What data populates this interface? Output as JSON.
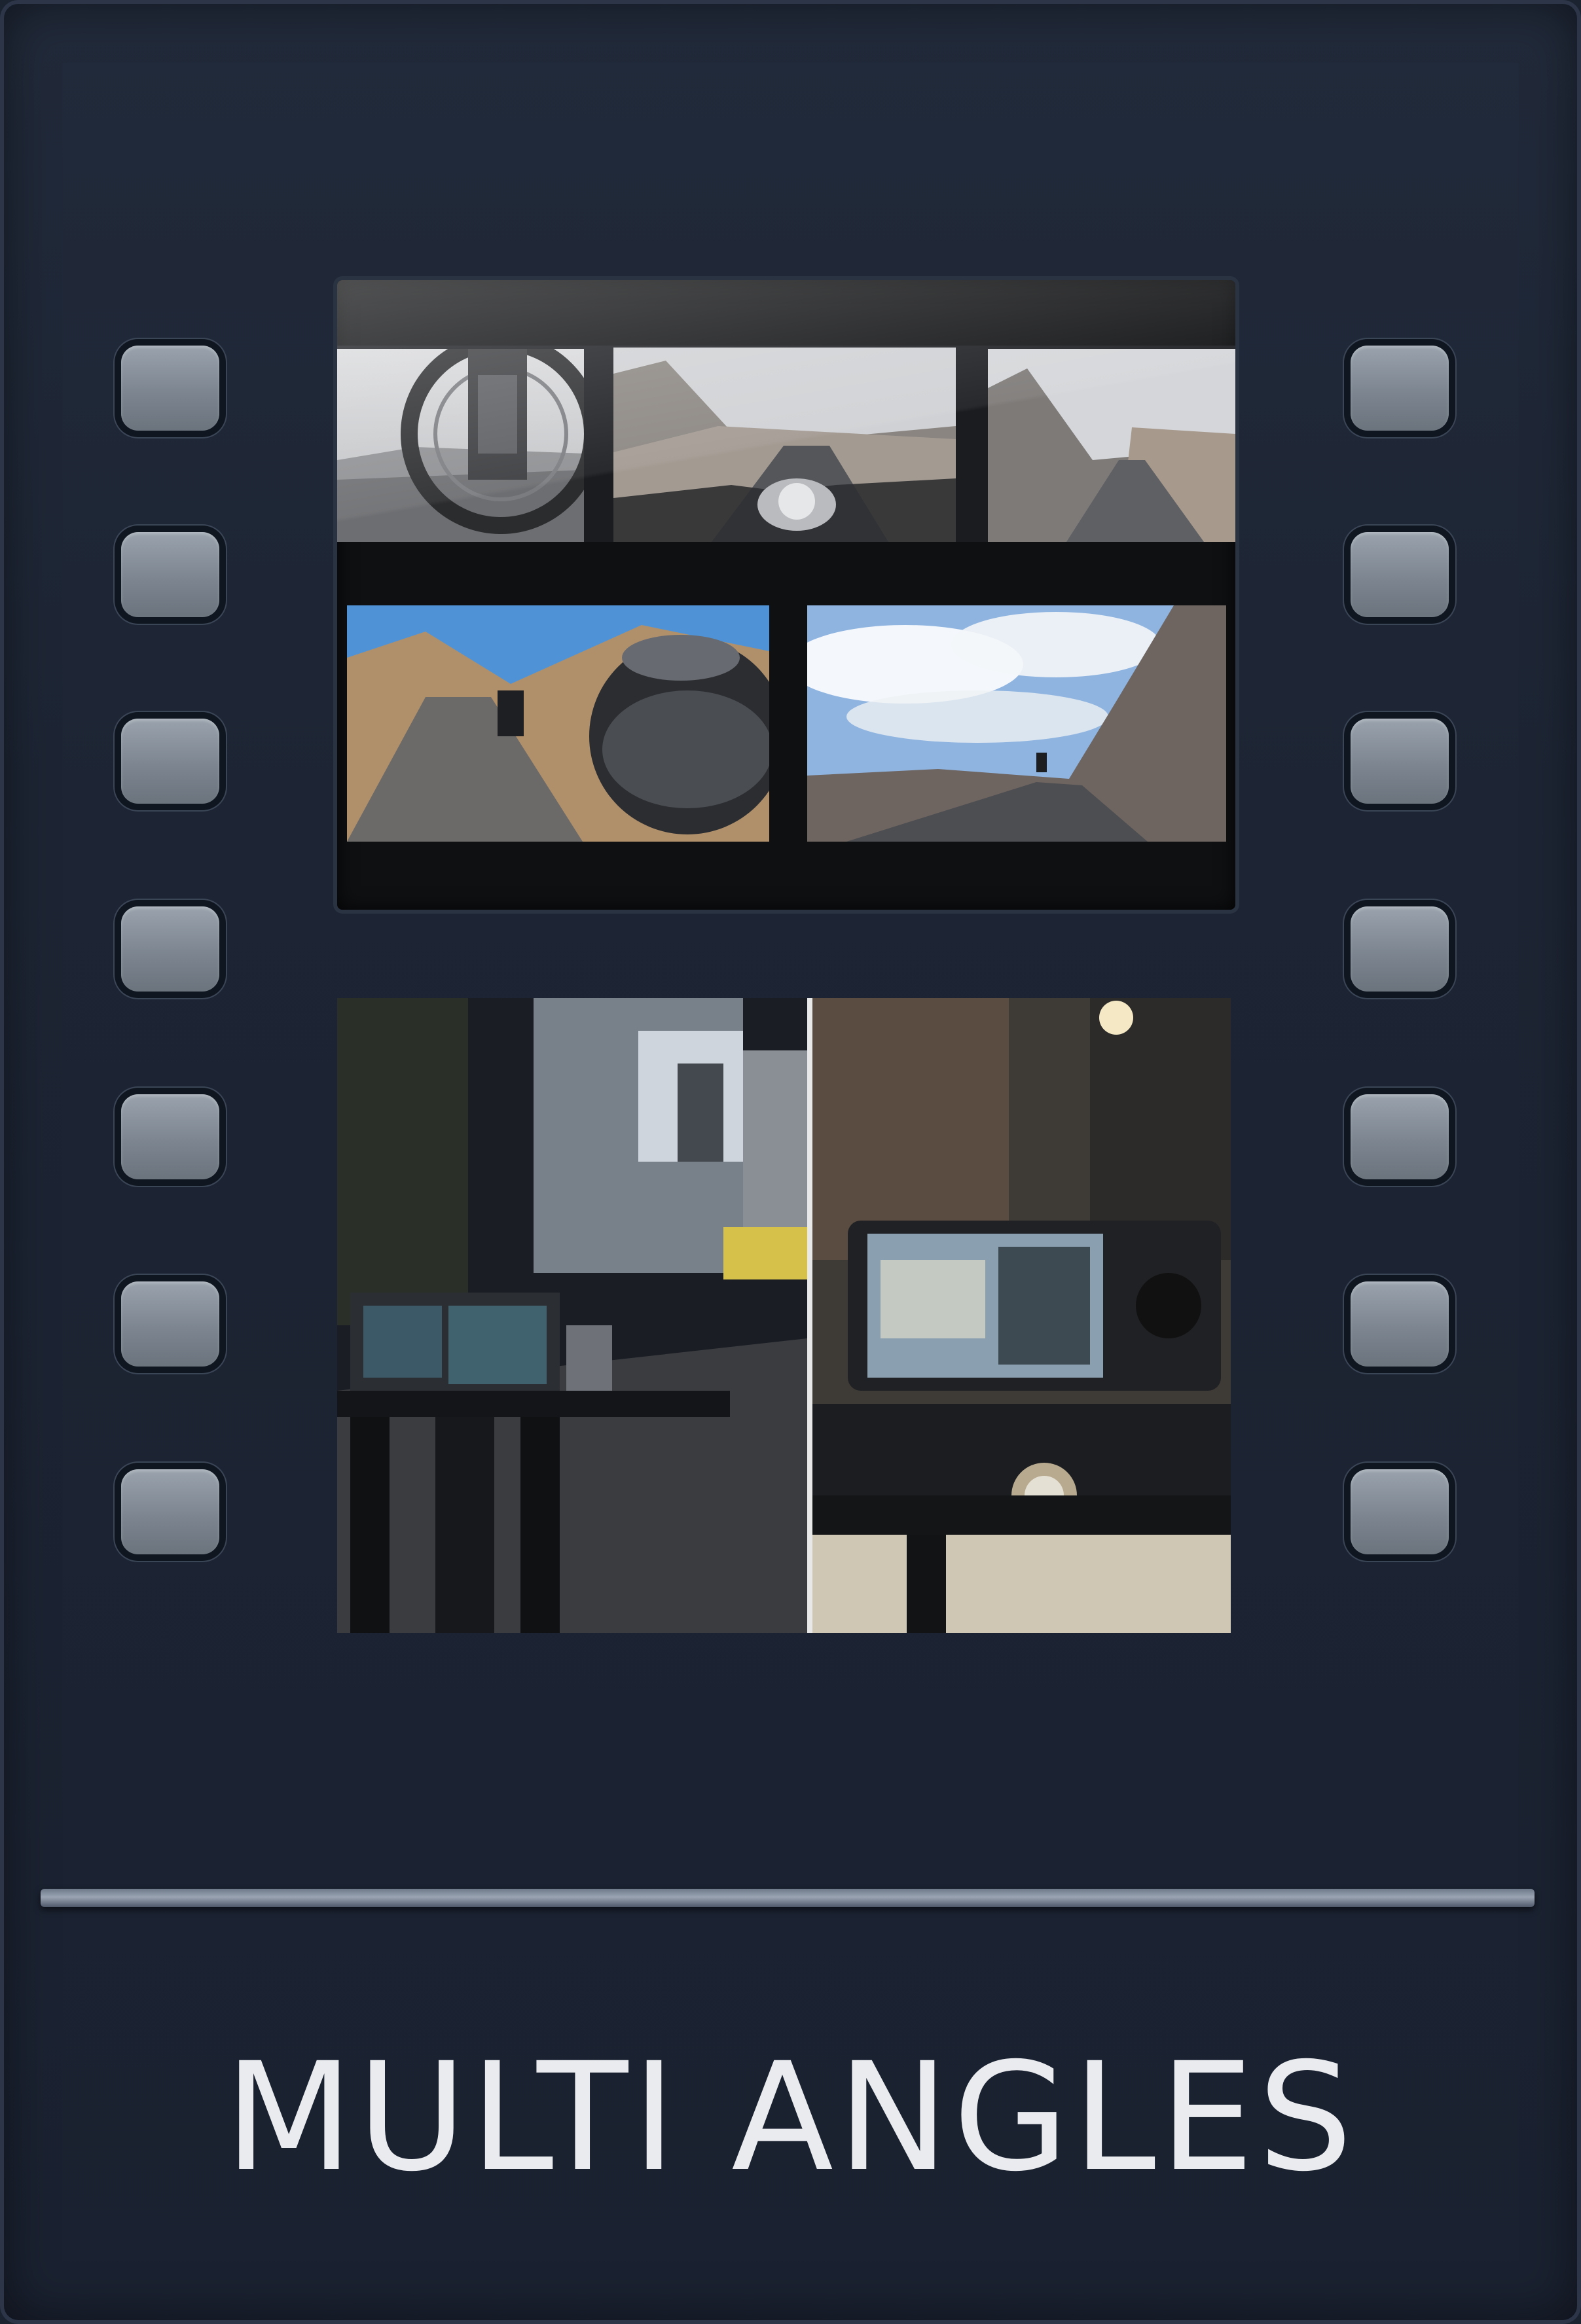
{
  "title": "MULTI ANGLES",
  "colors": {
    "background": "#1d2534",
    "sprocket": "#8a929c",
    "frame": "#0f1012",
    "title_text": "#e9ebee"
  },
  "sprocket_rows": 7,
  "top_frame": {
    "strip_images": [
      "motorcycle-wheel-view",
      "handlebar-mountain-road-view",
      "mountain-road-view"
    ],
    "lower_images": [
      "helmet-selfie-with-rider-behind",
      "rider-on-cliff-road"
    ]
  },
  "bottom_frame": {
    "images": [
      "night-city-street-camera-rig",
      "camera-on-slider-closeup"
    ]
  }
}
